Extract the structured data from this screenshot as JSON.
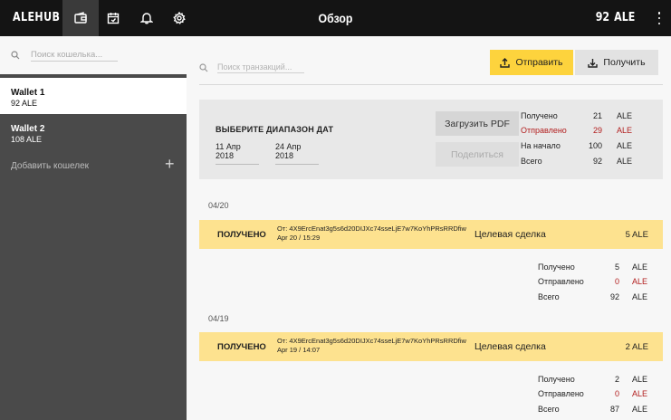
{
  "header": {
    "logo": "ALEHUB",
    "title": "Обзор",
    "balance_value": "92",
    "balance_currency": "ALE"
  },
  "nav": [
    "wallet-icon",
    "calendar-icon",
    "bell-icon",
    "gear-icon"
  ],
  "sidebar": {
    "search_placeholder": "Поиск кошелька...",
    "wallets": [
      {
        "name": "Wallet 1",
        "amount": "92 ALE"
      },
      {
        "name": "Wallet 2",
        "amount": "108 ALE"
      }
    ],
    "add_label": "Добавить кошелек",
    "add_symbol": "+"
  },
  "main": {
    "search_placeholder": "Поиск транзакций...",
    "send_label": "Отправить",
    "receive_label": "Получить",
    "range": {
      "title": "ВЫБЕРИТЕ ДИАПАЗОН ДАТ",
      "date_from": "11 Апр 2018",
      "date_to": "24 Апр 2018",
      "pdf_label": "Загрузить PDF",
      "share_label": "Поделиться",
      "stats": [
        {
          "label": "Получено",
          "value": "21",
          "currency": "ALE",
          "highlight": false
        },
        {
          "label": "Отправлено",
          "value": "29",
          "currency": "ALE",
          "highlight": true
        },
        {
          "label": "На начало",
          "value": "100",
          "currency": "ALE",
          "highlight": false
        },
        {
          "label": "Всего",
          "value": "92",
          "currency": "ALE",
          "highlight": false
        }
      ]
    },
    "groups": [
      {
        "date": "04/20",
        "tx": {
          "status": "ПОЛУЧЕНО",
          "from": "От: 4X9ErcEnat3g5s6d20DIJXc74sseLjE7w7KoYhPRsRRDfiw",
          "datetime": "Apr 20 / 15:29",
          "type": "Целевая сделка",
          "amount": "5 ALE"
        },
        "stats": [
          {
            "label": "Получено",
            "value": "5",
            "currency": "ALE",
            "highlight": false
          },
          {
            "label": "Отправлено",
            "value": "0",
            "currency": "ALE",
            "highlight": true
          },
          {
            "label": "Всего",
            "value": "92",
            "currency": "ALE",
            "highlight": false
          }
        ]
      },
      {
        "date": "04/19",
        "tx": {
          "status": "ПОЛУЧЕНО",
          "from": "От: 4X9ErcEnat3g5s6d20DIJXc74sseLjE7w7KoYhPRsRRDfiw",
          "datetime": "Apr 19 / 14:07",
          "type": "Целевая сделка",
          "amount": "2 ALE"
        },
        "stats": [
          {
            "label": "Получено",
            "value": "2",
            "currency": "ALE",
            "highlight": false
          },
          {
            "label": "Отправлено",
            "value": "0",
            "currency": "ALE",
            "highlight": true
          },
          {
            "label": "Всего",
            "value": "87",
            "currency": "ALE",
            "highlight": false
          }
        ]
      }
    ]
  },
  "colors": {
    "topbar": "#141414",
    "sidebar": "#4a4a4a",
    "accent": "#fdd33d",
    "tx_row": "#fde28f",
    "negative": "#b21e1e"
  }
}
